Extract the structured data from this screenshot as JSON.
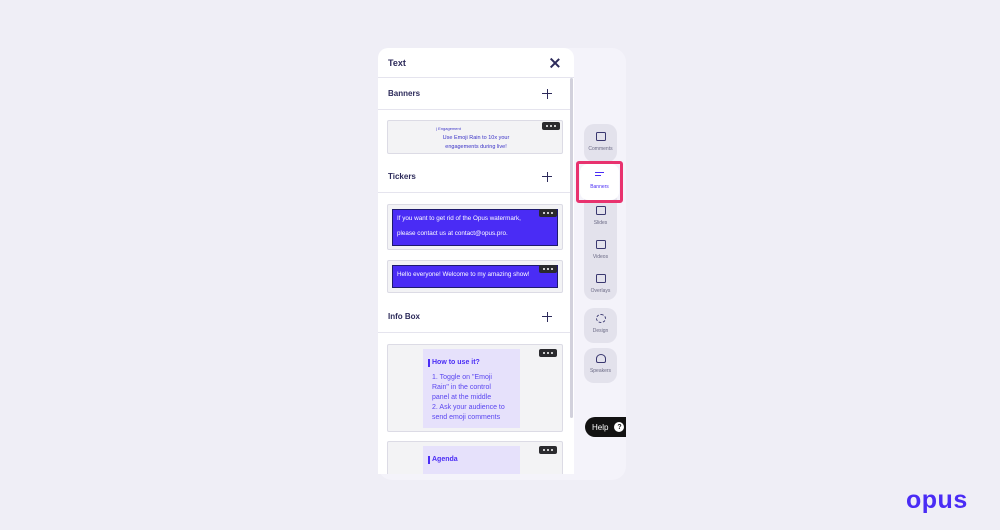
{
  "panel": {
    "title": "Text"
  },
  "sections": {
    "banners": "Banners",
    "tickers": "Tickers",
    "info_box": "Info Box"
  },
  "banner_card": {
    "tag": "| Engagement",
    "text": "Use Emoji Rain to 10x your\nengagements during live!"
  },
  "ticker_cards": [
    {
      "text": "If you want to get rid of the Opus watermark,\nplease contact us at contact@opus.pro."
    },
    {
      "text": "Hello everyone! Welcome to my amazing show!"
    }
  ],
  "info_cards": [
    {
      "heading": "How to use it?",
      "body": "1. Toggle on \"Emoji\nRain\" in the control\npanel at the middle\n2. Ask your audience to\nsend emoji comments"
    },
    {
      "heading": "Agenda",
      "body": ""
    }
  ],
  "rail": {
    "items": [
      {
        "label": "Comments",
        "icon": "comment-icon"
      },
      {
        "label": "Banners",
        "icon": "banner-lines-icon",
        "active": true
      },
      {
        "label": "Slides",
        "icon": "slides-icon"
      },
      {
        "label": "Videos",
        "icon": "video-icon"
      },
      {
        "label": "Overlays",
        "icon": "overlay-icon"
      },
      {
        "label": "Design",
        "icon": "design-tools-icon"
      },
      {
        "label": "Speakers",
        "icon": "speakers-icon"
      }
    ],
    "active_color": "#e8326e"
  },
  "help": {
    "label": "Help",
    "icon_glyph": "?"
  },
  "brand": {
    "logo": "opus",
    "accent": "#4a2cf5"
  }
}
